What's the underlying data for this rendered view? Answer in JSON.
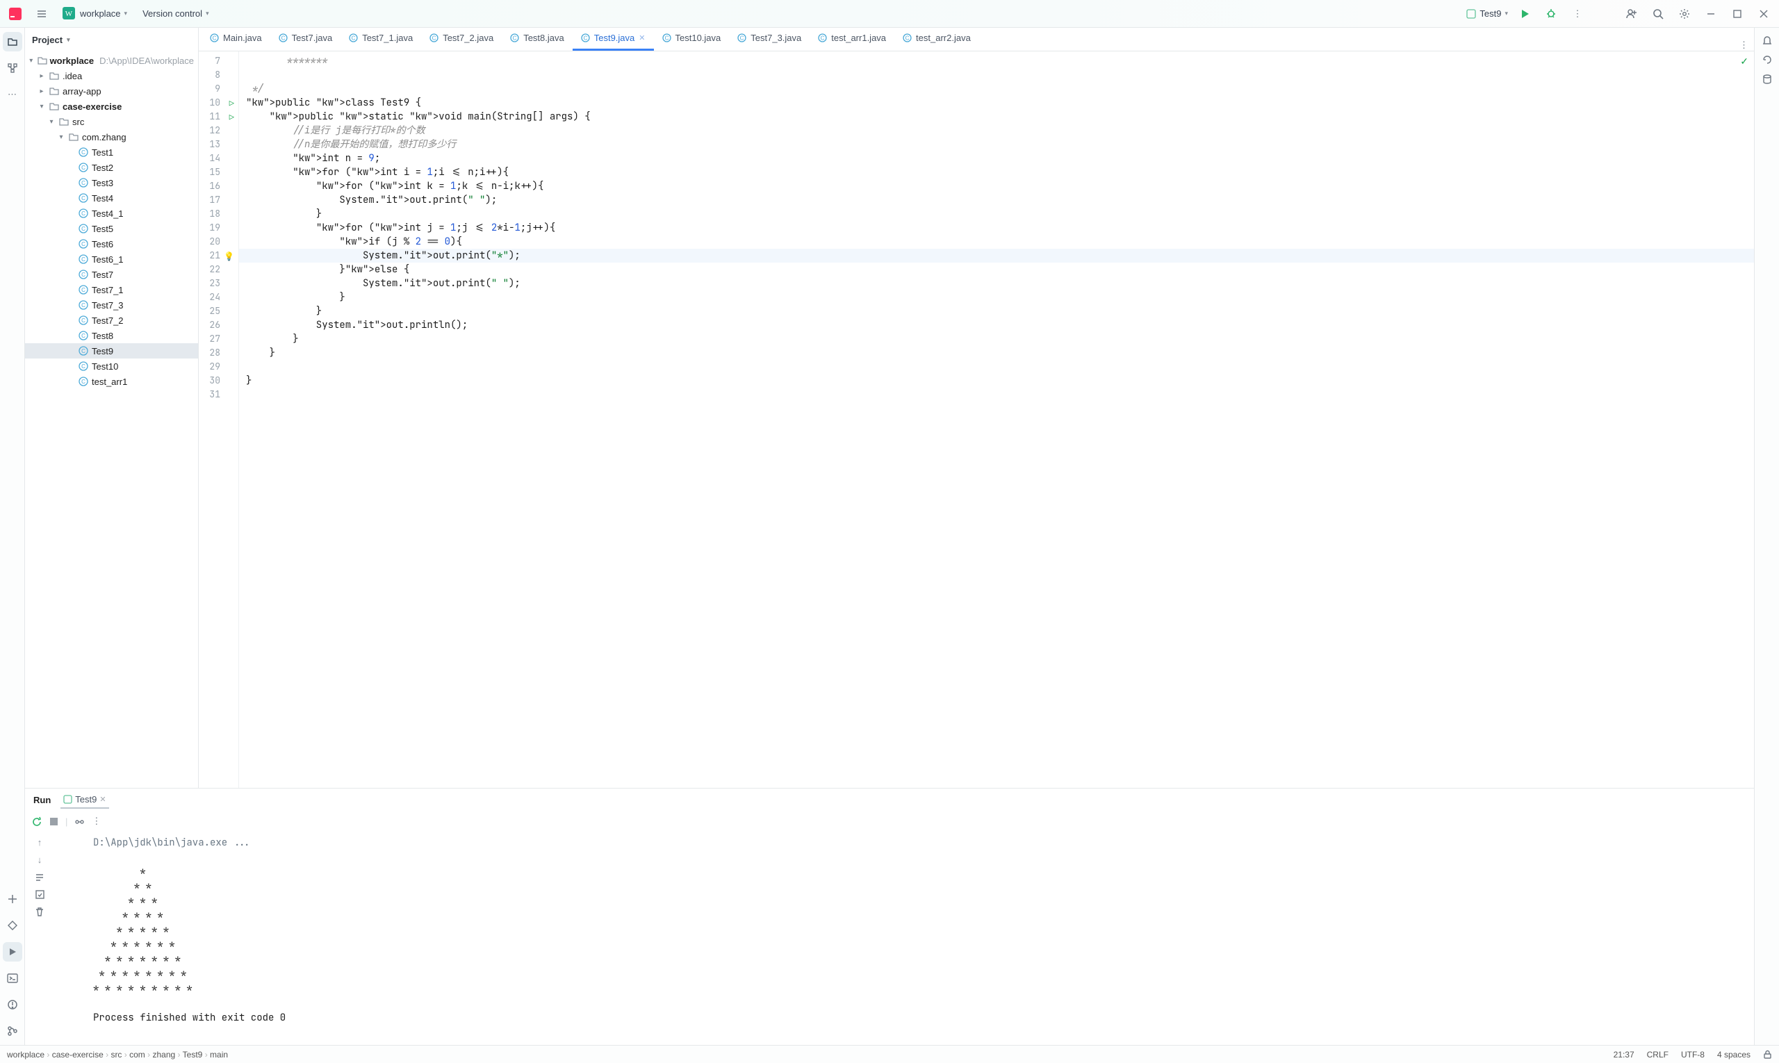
{
  "header": {
    "workspace": "workplace",
    "vcs": "Version control",
    "run_config": "Test9"
  },
  "project": {
    "title": "Project",
    "root": {
      "name": "workplace",
      "path": "D:\\App\\IDEA\\workplace"
    },
    "folders": {
      "idea": ".idea",
      "array": "array-app",
      "case": "case-exercise",
      "src": "src",
      "pkg": "com.zhang"
    },
    "files": [
      "Test1",
      "Test2",
      "Test3",
      "Test4",
      "Test4_1",
      "Test5",
      "Test6",
      "Test6_1",
      "Test7",
      "Test7_1",
      "Test7_3",
      "Test7_2",
      "Test8",
      "Test9",
      "Test10",
      "test_arr1"
    ]
  },
  "tabs": [
    "Main.java",
    "Test7.java",
    "Test7_1.java",
    "Test7_2.java",
    "Test8.java",
    "Test9.java",
    "Test10.java",
    "Test7_3.java",
    "test_arr1.java",
    "test_arr2.java"
  ],
  "active_tab": 5,
  "code": {
    "start": 7,
    "lines": [
      {
        "t": "       *******",
        "cls": "cm"
      },
      {
        "t": "",
        "cls": ""
      },
      {
        "t": " */",
        "cls": "cm"
      },
      {
        "t": "public class Test9 {",
        "cls": "",
        "run": true
      },
      {
        "t": "    public static void main(String[] args) {",
        "cls": "",
        "run": true
      },
      {
        "t": "        //i是行 j是每行打印*的个数",
        "cls": "cm"
      },
      {
        "t": "        //n是你最开始的赋值，想打印多少行",
        "cls": "cm"
      },
      {
        "t": "        int n = 9;",
        "cls": ""
      },
      {
        "t": "        for (int i = 1;i <= n;i++){",
        "cls": ""
      },
      {
        "t": "            for (int k = 1;k <= n-i;k++){",
        "cls": ""
      },
      {
        "t": "                System.out.print(\" \");",
        "cls": ""
      },
      {
        "t": "            }",
        "cls": ""
      },
      {
        "t": "            for (int j = 1;j <= 2*i-1;j++){",
        "cls": ""
      },
      {
        "t": "                if (j % 2 == 0){",
        "cls": ""
      },
      {
        "t": "                    System.out.print(\"*\");",
        "cls": "",
        "hl": true,
        "bulb": true
      },
      {
        "t": "                }else {",
        "cls": ""
      },
      {
        "t": "                    System.out.print(\" \");",
        "cls": ""
      },
      {
        "t": "                }",
        "cls": ""
      },
      {
        "t": "            }",
        "cls": ""
      },
      {
        "t": "            System.out.println();",
        "cls": ""
      },
      {
        "t": "        }",
        "cls": ""
      },
      {
        "t": "    }",
        "cls": ""
      },
      {
        "t": "",
        "cls": ""
      },
      {
        "t": "}",
        "cls": ""
      },
      {
        "t": "",
        "cls": ""
      }
    ]
  },
  "run_panel": {
    "title": "Run",
    "tab": "Test9",
    "output": "D:\\App\\jdk\\bin\\java.exe ...\n\n        *\n       * *\n      * * *\n     * * * *\n    * * * * *\n   * * * * * *\n  * * * * * * *\n * * * * * * * *\n* * * * * * * * *\n\nProcess finished with exit code 0"
  },
  "breadcrumb": [
    "workplace",
    "case-exercise",
    "src",
    "com",
    "zhang",
    "Test9",
    "main"
  ],
  "status": {
    "pos": "21:37",
    "eol": "CRLF",
    "enc": "UTF-8",
    "indent": "4 spaces"
  }
}
